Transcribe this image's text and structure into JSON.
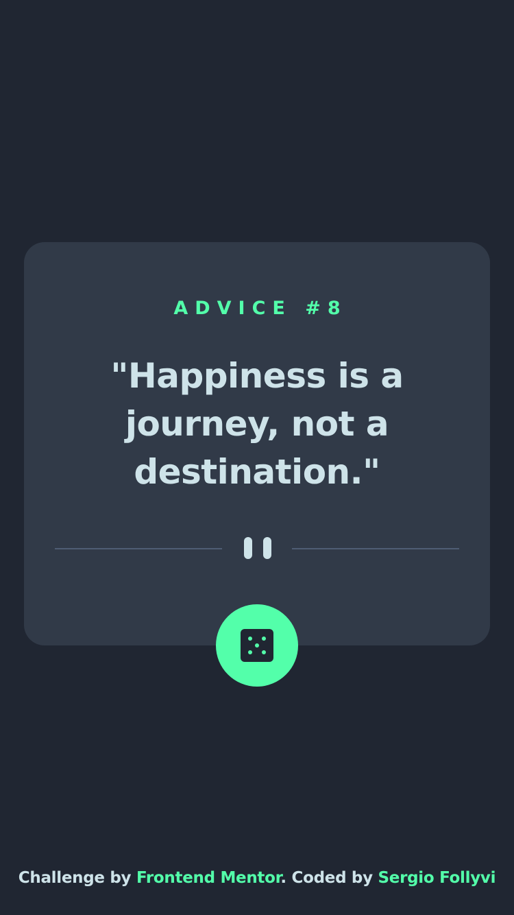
{
  "advice": {
    "label": "ADVICE #8",
    "quote": "\"Happiness is a journey, not a destination.\""
  },
  "dice_button": {
    "icon": "dice-icon"
  },
  "divider": {
    "icon": "pause-icon"
  },
  "footer": {
    "challenge_by": "Challenge by ",
    "challenge_link": "Frontend Mentor",
    "coded_by": ". Coded by ",
    "author_link": "Sergio Follyvi"
  },
  "colors": {
    "background": "#202632",
    "card": "#313a48",
    "accent": "#53ffaa",
    "text": "#cee3e9",
    "divider": "#4f5d74"
  }
}
